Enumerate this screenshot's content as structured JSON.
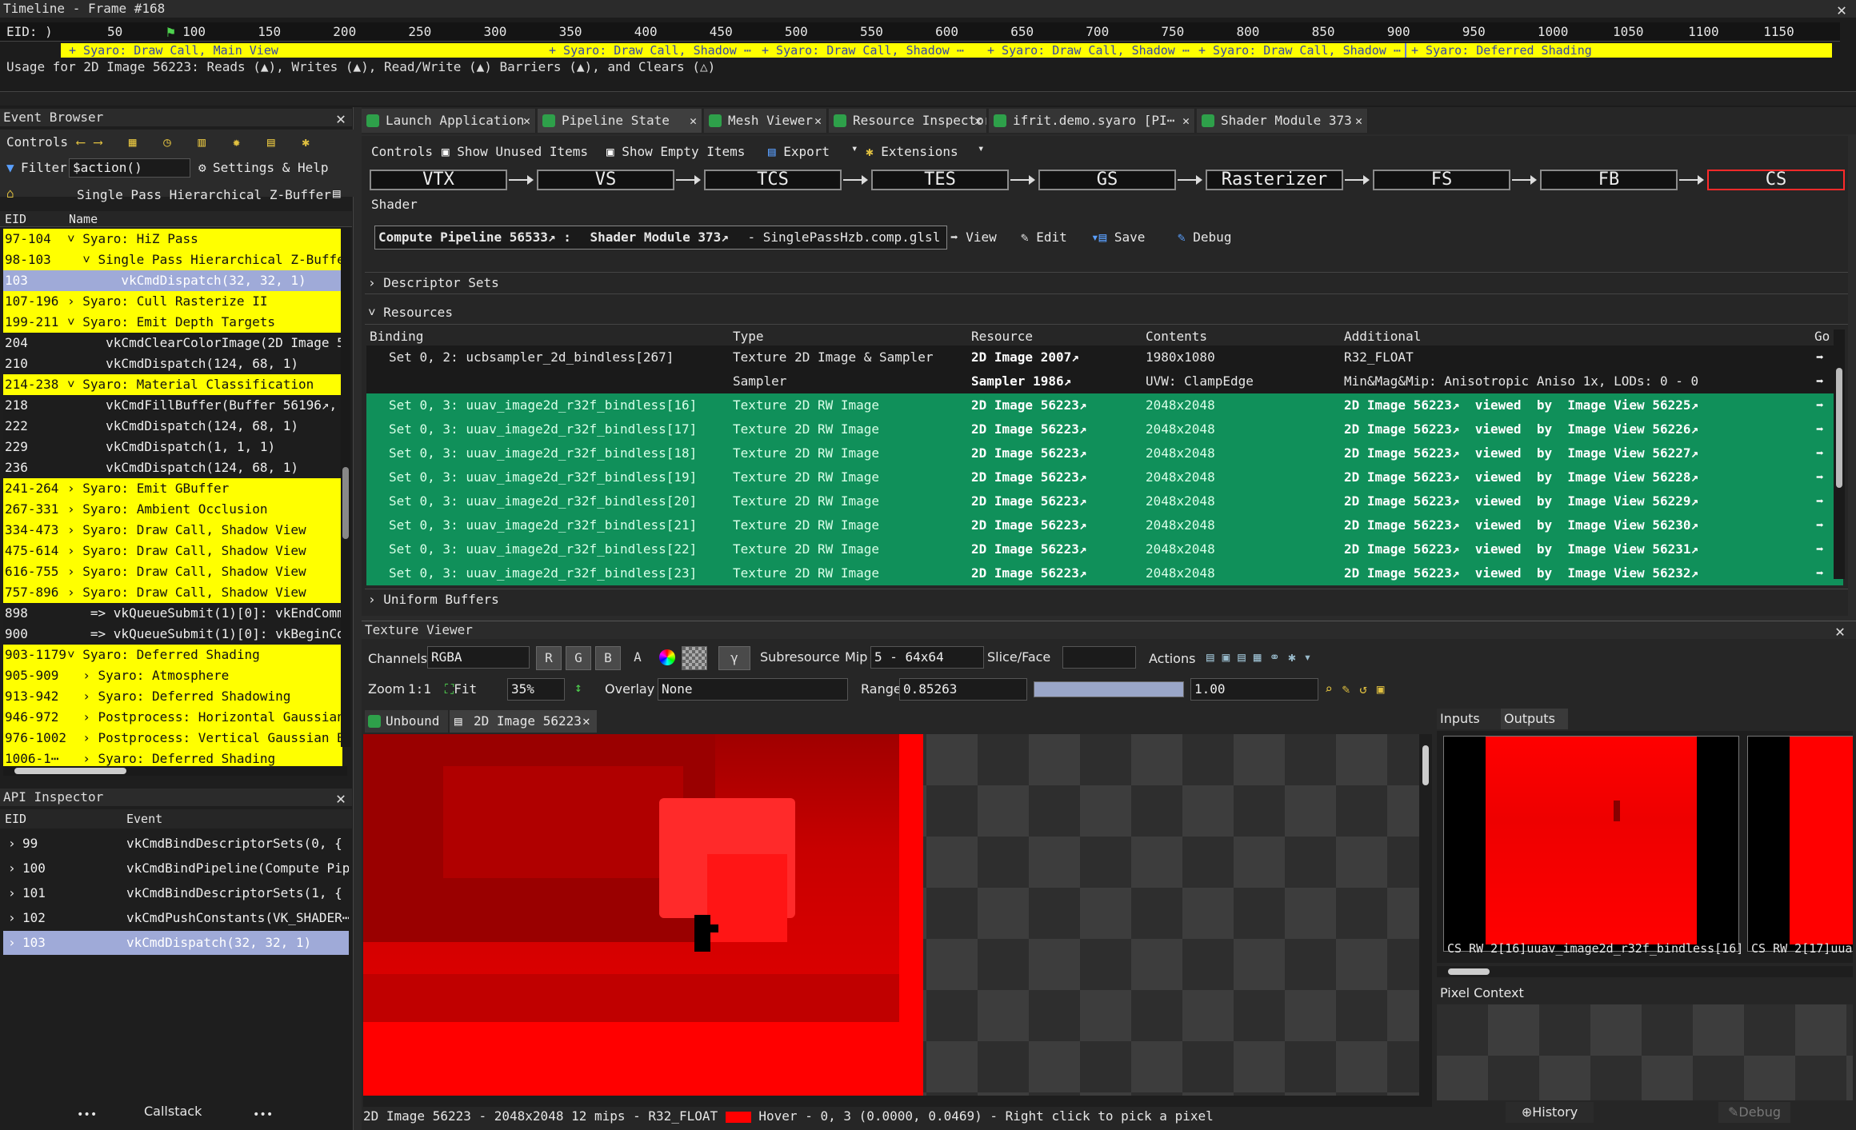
{
  "timeline": {
    "title": "Timeline - Frame #168",
    "eid_label": "EID: )",
    "ticks": [
      "50",
      "100",
      "150",
      "200",
      "250",
      "300",
      "350",
      "400",
      "450",
      "500",
      "550",
      "600",
      "650",
      "700",
      "750",
      "800",
      "850",
      "900",
      "950",
      "1000",
      "1050",
      "1100",
      "1150"
    ],
    "markers": [
      "+ Syaro: Draw Call, Main View",
      "+ Syaro: Draw Call, Shadow ⋯",
      "+ Syaro: Draw Call, Shadow ⋯",
      "+ Syaro: Draw Call, Shadow ⋯",
      "+ Syaro: Draw Call, Shadow ⋯",
      "+ Syaro: Deferred Shading"
    ],
    "usage_text": "Usage for 2D Image 56223: Reads (▲), Writes (▲), Read/Write (▲) Barriers (▲), and Clears (△)"
  },
  "event_browser": {
    "title": "Event Browser",
    "controls_label": "Controls",
    "filter_label": "Filter",
    "filter_value": "$action()",
    "settings_label": "Settings & Help",
    "breadcrumb": "Single Pass Hierarchical Z-Buffer",
    "col_eid": "EID",
    "col_name": "Name",
    "rows": [
      {
        "eid": "97-104",
        "name": "˅ Syaro: HiZ Pass",
        "style": "y"
      },
      {
        "eid": "98-103",
        "name": "  ˅ Single Pass Hierarchical Z-Buffer",
        "style": "y"
      },
      {
        "eid": "103",
        "name": "       vkCmdDispatch(32, 32, 1)",
        "style": "sel"
      },
      {
        "eid": "107-196",
        "name": "› Syaro: Cull Rasterize II",
        "style": "y"
      },
      {
        "eid": "199-211",
        "name": "˅ Syaro: Emit Depth Targets",
        "style": "y"
      },
      {
        "eid": "204",
        "name": "     vkCmdClearColorImage(2D Image 5",
        "style": "g"
      },
      {
        "eid": "210",
        "name": "     vkCmdDispatch(124, 68, 1)",
        "style": "g"
      },
      {
        "eid": "214-238",
        "name": "˅ Syaro: Material Classification",
        "style": "y"
      },
      {
        "eid": "218",
        "name": "     vkCmdFillBuffer(Buffer 56196↗,",
        "style": "g"
      },
      {
        "eid": "222",
        "name": "     vkCmdDispatch(124, 68, 1)",
        "style": "g"
      },
      {
        "eid": "229",
        "name": "     vkCmdDispatch(1, 1, 1)",
        "style": "g"
      },
      {
        "eid": "236",
        "name": "     vkCmdDispatch(124, 68, 1)",
        "style": "g"
      },
      {
        "eid": "241-264",
        "name": "› Syaro: Emit GBuffer",
        "style": "y"
      },
      {
        "eid": "267-331",
        "name": "› Syaro: Ambient Occlusion",
        "style": "y"
      },
      {
        "eid": "334-473",
        "name": "› Syaro: Draw Call, Shadow View",
        "style": "y"
      },
      {
        "eid": "475-614",
        "name": "› Syaro: Draw Call, Shadow View",
        "style": "y"
      },
      {
        "eid": "616-755",
        "name": "› Syaro: Draw Call, Shadow View",
        "style": "y"
      },
      {
        "eid": "757-896",
        "name": "› Syaro: Draw Call, Shadow View",
        "style": "y"
      },
      {
        "eid": "898",
        "name": "   => vkQueueSubmit(1)[0]: vkEndComm",
        "style": "g"
      },
      {
        "eid": "900",
        "name": "   => vkQueueSubmit(1)[0]: vkBeginCom",
        "style": "g"
      },
      {
        "eid": "903-1179",
        "name": "˅ Syaro: Deferred Shading",
        "style": "y"
      },
      {
        "eid": "905-909",
        "name": "  › Syaro: Atmosphere",
        "style": "y"
      },
      {
        "eid": "913-942",
        "name": "  › Syaro: Deferred Shadowing",
        "style": "y"
      },
      {
        "eid": "946-972",
        "name": "  › Postprocess: Horizontal Gaussian B",
        "style": "y"
      },
      {
        "eid": "976-1002",
        "name": "  › Postprocess: Vertical Gaussian Blu",
        "style": "y"
      },
      {
        "eid": "1006-1⋯",
        "name": "  › Syaro: Deferred Shading",
        "style": "y"
      }
    ]
  },
  "api_inspector": {
    "title": "API Inspector",
    "col_eid": "EID",
    "col_event": "Event",
    "rows": [
      {
        "eid": "99",
        "event": "vkCmdBindDescriptorSets(0, {"
      },
      {
        "eid": "100",
        "event": "vkCmdBindPipeline(Compute Pipe"
      },
      {
        "eid": "101",
        "event": "vkCmdBindDescriptorSets(1, {"
      },
      {
        "eid": "102",
        "event": "vkCmdPushConstants(VK_SHADER⋯"
      },
      {
        "eid": "103",
        "event": "vkCmdDispatch(32, 32, 1)"
      }
    ],
    "callstack_label": "Callstack",
    "dots": "•••"
  },
  "tabs": [
    {
      "label": "Launch Application"
    },
    {
      "label": "Pipeline State"
    },
    {
      "label": "Mesh Viewer"
    },
    {
      "label": "Resource Inspector"
    },
    {
      "label": "ifrit.demo.syaro [PI⋯"
    },
    {
      "label": "Shader Module 373"
    }
  ],
  "pipeline": {
    "controls_label": "Controls",
    "show_unused": "Show Unused Items",
    "show_empty": "Show Empty Items",
    "export": "Export",
    "extensions": "Extensions",
    "stages": [
      "VTX",
      "VS",
      "TCS",
      "TES",
      "GS",
      "Rasterizer",
      "FS",
      "FB",
      "CS"
    ],
    "shader_label": "Shader",
    "compute_pipeline": "Compute Pipeline 56533↗ :",
    "shader_module": "Shader Module 373↗",
    "shader_file": "- SinglePassHzb.comp.glsl",
    "view": "View",
    "edit": "Edit",
    "save": "Save",
    "debug": "Debug",
    "descriptor_sets": "Descriptor Sets",
    "resources": "Resources",
    "uniform_buffers": "Uniform Buffers",
    "columns": [
      "Binding",
      "Type",
      "Resource",
      "Contents",
      "Additional",
      "Go"
    ],
    "rows": [
      {
        "binding": "Set 0, 2: ucbsampler_2d_bindless[267]",
        "type": "Texture 2D Image & Sampler",
        "resource": "2D Image 2007↗",
        "contents": "1980x1080",
        "additional": "R32_FLOAT",
        "style": "dark"
      },
      {
        "binding": "",
        "type": "Sampler",
        "resource": "Sampler 1986↗",
        "contents": "UVW: ClampEdge",
        "additional": "Min&Mag&Mip: Anisotropic Aniso 1x, LODs: 0 - 0",
        "style": "dark"
      },
      {
        "binding": "Set 0, 3: uuav_image2d_r32f_bindless[16]",
        "type": "Texture 2D RW Image",
        "resource": "2D Image 56223↗",
        "contents": "2048x2048",
        "additional": "2D Image 56223↗  viewed  by  Image View 56225↗",
        "style": "green"
      },
      {
        "binding": "Set 0, 3: uuav_image2d_r32f_bindless[17]",
        "type": "Texture 2D RW Image",
        "resource": "2D Image 56223↗",
        "contents": "2048x2048",
        "additional": "2D Image 56223↗  viewed  by  Image View 56226↗",
        "style": "green"
      },
      {
        "binding": "Set 0, 3: uuav_image2d_r32f_bindless[18]",
        "type": "Texture 2D RW Image",
        "resource": "2D Image 56223↗",
        "contents": "2048x2048",
        "additional": "2D Image 56223↗  viewed  by  Image View 56227↗",
        "style": "green"
      },
      {
        "binding": "Set 0, 3: uuav_image2d_r32f_bindless[19]",
        "type": "Texture 2D RW Image",
        "resource": "2D Image 56223↗",
        "contents": "2048x2048",
        "additional": "2D Image 56223↗  viewed  by  Image View 56228↗",
        "style": "green"
      },
      {
        "binding": "Set 0, 3: uuav_image2d_r32f_bindless[20]",
        "type": "Texture 2D RW Image",
        "resource": "2D Image 56223↗",
        "contents": "2048x2048",
        "additional": "2D Image 56223↗  viewed  by  Image View 56229↗",
        "style": "green"
      },
      {
        "binding": "Set 0, 3: uuav_image2d_r32f_bindless[21]",
        "type": "Texture 2D RW Image",
        "resource": "2D Image 56223↗",
        "contents": "2048x2048",
        "additional": "2D Image 56223↗  viewed  by  Image View 56230↗",
        "style": "green"
      },
      {
        "binding": "Set 0, 3: uuav_image2d_r32f_bindless[22]",
        "type": "Texture 2D RW Image",
        "resource": "2D Image 56223↗",
        "contents": "2048x2048",
        "additional": "2D Image 56223↗  viewed  by  Image View 56231↗",
        "style": "green"
      },
      {
        "binding": "Set 0, 3: uuav_image2d_r32f_bindless[23]",
        "type": "Texture 2D RW Image",
        "resource": "2D Image 56223↗",
        "contents": "2048x2048",
        "additional": "2D Image 56223↗  viewed  by  Image View 56232↗",
        "style": "green"
      }
    ]
  },
  "texture_viewer": {
    "title": "Texture Viewer",
    "channels_label": "Channels",
    "channels_value": "RGBA",
    "chan_buttons": [
      "R",
      "G",
      "B",
      "A"
    ],
    "gamma": "γ",
    "subresource_label": "Subresource",
    "mip_label": "Mip",
    "mip_value": "5 - 64x64",
    "slice_label": "Slice/Face",
    "actions_label": "Actions",
    "zoom_label": "Zoom",
    "zoom_1to1": "1:1",
    "fit": "Fit",
    "zoom_value": "35%",
    "overlay_label": "Overlay",
    "overlay_value": "None",
    "range_label": "Range",
    "range_min": "0.85263",
    "range_max": "1.00",
    "tab_unbound": "Unbound",
    "tab_image": "2D Image 56223",
    "inputs_label": "Inputs",
    "outputs_label": "Outputs",
    "thumb1_label": "CS RW 2[16]uuav_image2d_r32f_bindless[16]",
    "thumb2_label": "CS RW 2[17]uua",
    "pixel_context": "Pixel Context",
    "history": "History",
    "debug": "Debug",
    "status_text": "2D Image 56223 - 2048x2048 12 mips - R32_FLOAT",
    "hover_text": "Hover -     0,    3 (0.0000, 0.0469)  - Right click to pick a pixel"
  }
}
